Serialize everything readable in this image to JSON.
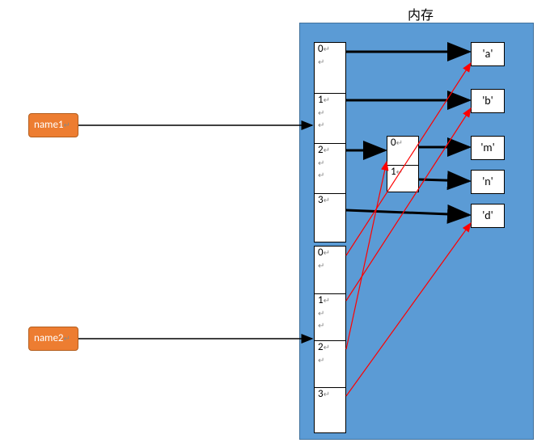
{
  "title": "内存",
  "names": {
    "left1": "name1",
    "left2": "name2"
  },
  "array1": {
    "indices": [
      "0",
      "1",
      "2",
      "3"
    ]
  },
  "array2": {
    "indices": [
      "0",
      "1",
      "2",
      "3"
    ]
  },
  "innerArray": {
    "indices": [
      "0",
      "1"
    ]
  },
  "values": {
    "a": "'a'",
    "b": "'b'",
    "m": "'m'",
    "n": "'n'",
    "d": "'d'"
  },
  "colors": {
    "panel": "#5b9bd5",
    "orange": "#ed7d31",
    "arrowBlack": "#000000",
    "arrowRed": "#ff0000"
  },
  "chart_data": {
    "type": "table",
    "title": "内存 (memory) reference diagram",
    "variables": [
      {
        "name": "name1",
        "points_to": "array1"
      },
      {
        "name": "name2",
        "points_to": "array2"
      }
    ],
    "array1": [
      {
        "index": 0,
        "ref": "'a'"
      },
      {
        "index": 1,
        "ref": "'b'"
      },
      {
        "index": 2,
        "ref": "innerArray"
      },
      {
        "index": 3,
        "ref": "'d'"
      }
    ],
    "array2": [
      {
        "index": 0,
        "ref": "'a'"
      },
      {
        "index": 1,
        "ref": "'b'"
      },
      {
        "index": 2,
        "ref": "innerArray"
      },
      {
        "index": 3,
        "ref": "'d'"
      }
    ],
    "innerArray": [
      {
        "index": 0,
        "ref": "'m'"
      },
      {
        "index": 1,
        "ref": "'n'"
      }
    ],
    "note": "red arrows = array2 element references; black arrows = array1 element references"
  }
}
